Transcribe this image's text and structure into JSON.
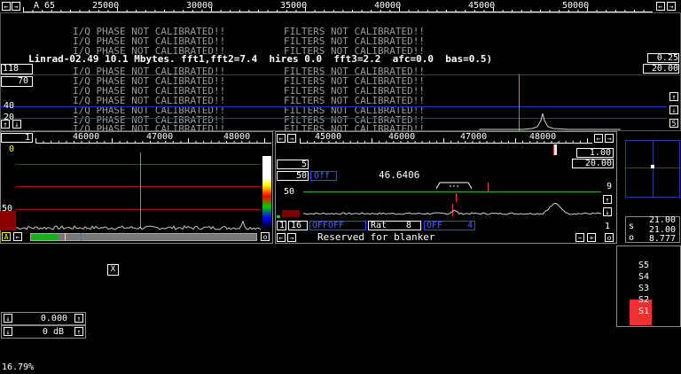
{
  "top_scale": {
    "label": "A 65",
    "ticks": [
      "25000",
      "30000",
      "35000",
      "40000",
      "45000",
      "50000"
    ]
  },
  "status_line": "Linrad-02.49 10.1 Mbytes. fft1,fft2=7.4  hires 0.0  fft3=2.2  afc=0.0  bas=0.5)",
  "warnings": {
    "iq": "I/Q PHASE NOT CALIBRATED!!",
    "filters": "FILTERS NOT CALIBRATED!!"
  },
  "wide_spectrum": {
    "left_values": [
      "118",
      "70",
      "40",
      "20"
    ],
    "right_values": [
      "0.25",
      "20.00"
    ],
    "right_button": "5"
  },
  "baseband_left": {
    "scale_left": "1",
    "ticks": [
      "46000",
      "47000",
      "48000"
    ],
    "top_value": "0",
    "mid_value": "50",
    "bottom_button": "A",
    "right_button": "o"
  },
  "baseband_right": {
    "ticks": [
      "45000",
      "46000",
      "47000",
      "48000"
    ],
    "val_1": "1.00",
    "val_2": "20.00",
    "left_5": "5",
    "left_50": "50",
    "off_label": "Off",
    "freq_readout": "46.6406",
    "level_50": "50",
    "right_9": "9",
    "bottom_row": {
      "n1": "1",
      "n16": "16",
      "offoff": "OFFOFF",
      "rat": "Rat",
      "rat_val": "8",
      "off2": "OFF",
      "off2_val": "4",
      "right_1": "1"
    },
    "reserved": "Reserved for blanker"
  },
  "polar": {
    "val_1": "21.00",
    "val_2": "21.00",
    "val_3": "8.777",
    "lbl_s": "s",
    "lbl_o": "o"
  },
  "smeter": {
    "labels": [
      "S5",
      "S4",
      "S3",
      "S2",
      "S1"
    ]
  },
  "close_x": "X",
  "bottom_controls": {
    "gain": "0.000",
    "db": "0 dB"
  },
  "cpu_load": "16.79%",
  "colors": {
    "accent_red": "#ff3030",
    "green": "#30c030",
    "blue": "#3040ff"
  }
}
